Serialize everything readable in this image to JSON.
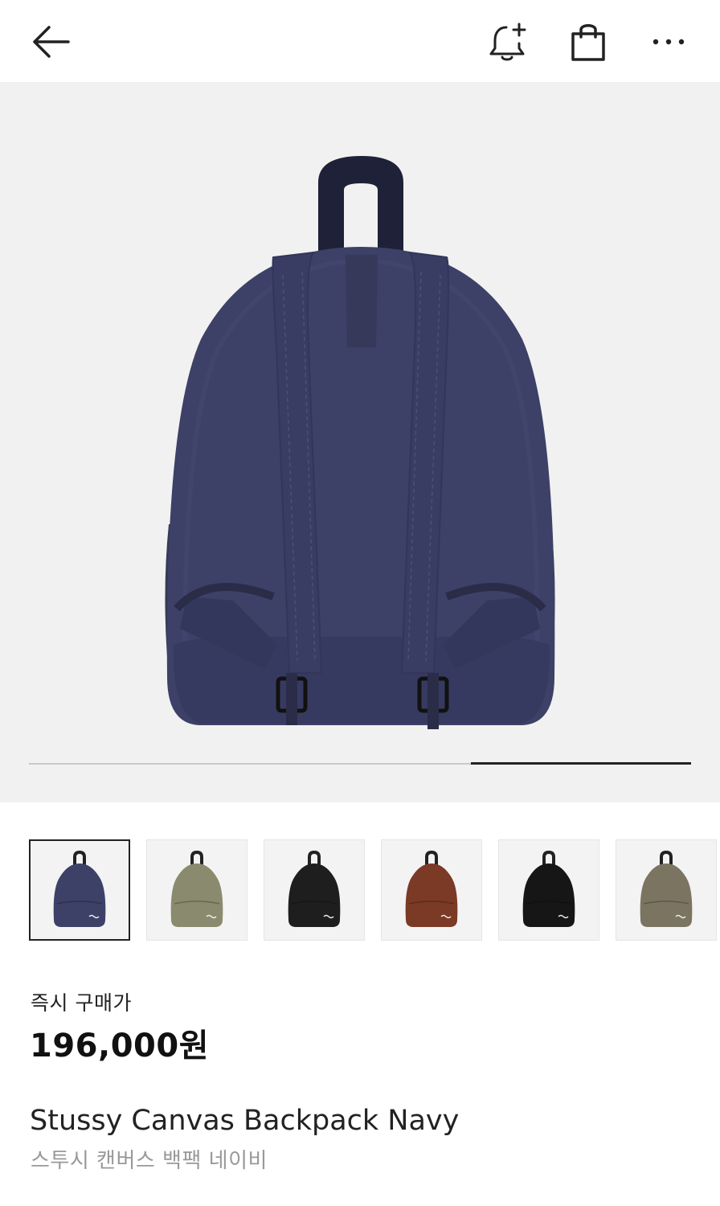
{
  "header": {
    "back_icon": "arrow-left-icon",
    "alert_icon": "bell-plus-icon",
    "cart_icon": "shopping-bag-icon",
    "more_icon": "more-horizontal-icon"
  },
  "gallery": {
    "image_icon": "backpack-navy-back-view",
    "progress_fraction_start": 0.667,
    "progress_fraction_end": 1.0
  },
  "colors": {
    "navy": "#3d4067",
    "olive": "#8b8a6f",
    "black": "#1e1e1e",
    "brown": "#7a3a26",
    "camo": "#7b7461"
  },
  "variants": [
    {
      "name": "Navy",
      "color": "#3d4067",
      "selected": true
    },
    {
      "name": "Olive",
      "color": "#8a8a6e",
      "selected": false
    },
    {
      "name": "Black",
      "color": "#1e1e1e",
      "selected": false
    },
    {
      "name": "Brown",
      "color": "#7a3a26",
      "selected": false
    },
    {
      "name": "Black",
      "color": "#161616",
      "selected": false
    },
    {
      "name": "Camo",
      "color": "#7b7461",
      "selected": false
    }
  ],
  "product": {
    "price_label": "즉시 구매가",
    "price": "196,000원",
    "name_en": "Stussy Canvas Backpack Navy",
    "name_ko": "스투시 캔버스 백팩 네이비"
  }
}
